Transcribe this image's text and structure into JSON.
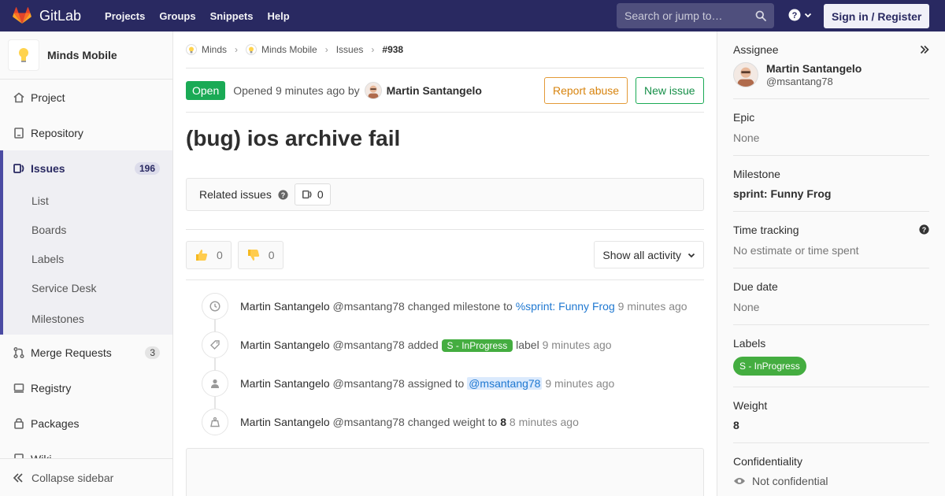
{
  "topnav": {
    "brand": "GitLab",
    "links": [
      "Projects",
      "Groups",
      "Snippets",
      "Help"
    ],
    "search_placeholder": "Search or jump to…",
    "signin": "Sign in / Register"
  },
  "sidebar": {
    "project_name": "Minds Mobile",
    "items": [
      {
        "label": "Project",
        "icon": "home-icon"
      },
      {
        "label": "Repository",
        "icon": "doc-icon"
      }
    ],
    "issues": {
      "label": "Issues",
      "count": "196"
    },
    "issues_sub": [
      "List",
      "Boards",
      "Labels",
      "Service Desk",
      "Milestones"
    ],
    "more_items": [
      {
        "label": "Merge Requests",
        "count": "3"
      },
      {
        "label": "Registry"
      },
      {
        "label": "Packages"
      },
      {
        "label": "Wiki"
      }
    ],
    "collapse_label": "Collapse sidebar"
  },
  "breadcrumbs": [
    "Minds",
    "Minds Mobile",
    "Issues",
    "#938"
  ],
  "issue": {
    "status": "Open",
    "opened_prefix": "Opened",
    "opened_time": "9 minutes ago",
    "opened_by": "by",
    "author": "Martin Santangelo",
    "report_abuse": "Report abuse",
    "new_issue": "New issue",
    "title": "(bug) ios archive fail",
    "related_label": "Related issues",
    "related_count": "0",
    "thumbs_up": "0",
    "thumbs_down": "0",
    "activity_filter": "Show all activity"
  },
  "timeline": [
    {
      "who": "Martin Santangelo",
      "handle": "@msantang78",
      "action": "changed milestone to",
      "link": "%sprint: Funny Frog",
      "time": "9 minutes ago"
    },
    {
      "who": "Martin Santangelo",
      "handle": "@msantang78",
      "action": "added",
      "label": "S - InProgress",
      "after": "label",
      "time": "9 minutes ago"
    },
    {
      "who": "Martin Santangelo",
      "handle": "@msantang78",
      "action": "assigned to",
      "mention": "@msantang78",
      "time": "9 minutes ago"
    },
    {
      "who": "Martin Santangelo",
      "handle": "@msantang78",
      "action": "changed weight to",
      "value": "8",
      "time": "8 minutes ago"
    }
  ],
  "right": {
    "assignee_h": "Assignee",
    "assignee_name": "Martin Santangelo",
    "assignee_handle": "@msantang78",
    "epic_h": "Epic",
    "epic_v": "None",
    "milestone_h": "Milestone",
    "milestone_v": "sprint: Funny Frog",
    "time_h": "Time tracking",
    "time_v": "No estimate or time spent",
    "due_h": "Due date",
    "due_v": "None",
    "labels_h": "Labels",
    "label_v": "S - InProgress",
    "weight_h": "Weight",
    "weight_v": "8",
    "conf_h": "Confidentiality",
    "conf_v": "Not confidential"
  },
  "colors": {
    "nav": "#292961",
    "open_green": "#1aaa55",
    "label_green": "#44ad40",
    "link_blue": "#1f78d1",
    "abuse_orange": "#e39a37"
  }
}
